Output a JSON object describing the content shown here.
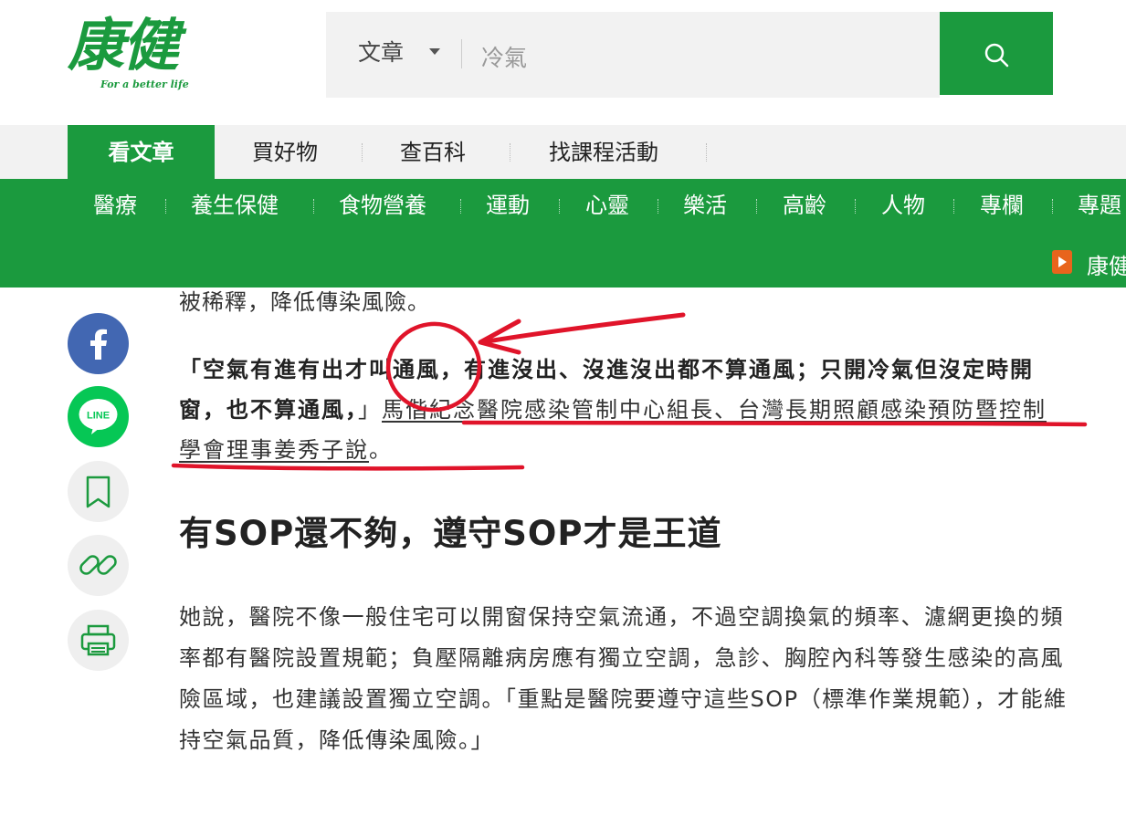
{
  "header": {
    "logo_text": "康健",
    "logo_tagline": "For a better life",
    "search_category": "文章",
    "search_value": "冷氣"
  },
  "main_nav": [
    {
      "label": "看文章",
      "active": true
    },
    {
      "label": "買好物",
      "active": false
    },
    {
      "label": "查百科",
      "active": false
    },
    {
      "label": "找課程活動",
      "active": false
    }
  ],
  "sub_nav": [
    "醫療",
    "養生保健",
    "食物營養",
    "運動",
    "心靈",
    "樂活",
    "高齡",
    "人物",
    "專欄",
    "專題"
  ],
  "sub_nav_extra": "康健",
  "share_icons": [
    "facebook-icon",
    "line-icon",
    "bookmark-icon",
    "link-icon",
    "print-icon"
  ],
  "share_labels": {
    "line": "LINE"
  },
  "article": {
    "p1": "被稀釋，降低傳染風險。",
    "p2_bold": "「空氣有進有出才叫通風，有進沒出、沒進沒出都不算通風；只開冷氣但沒定時開窗，也不算通風，",
    "p2_close": "」",
    "p2_link": "馬偕紀念醫院感染管制中心組長、台灣長期照顧感染預防暨控制學會理事姜秀子說",
    "p2_end": "。",
    "h2": "有SOP還不夠，遵守SOP才是王道",
    "p3": "她說，醫院不像一般住宅可以開窗保持空氣流通，不過空調換氣的頻率、濾網更換的頻率都有醫院設置規範；負壓隔離病房應有獨立空調，急診、胸腔內科等發生感染的高風險區域，也建議設置獨立空調。「重點是醫院要遵守這些SOP（標準作業規範），才能維持空氣品質，降低傳染風險。」"
  },
  "colors": {
    "brand_green": "#1b9a3e",
    "annotation_red": "#e0142a",
    "facebook_blue": "#4267b2",
    "line_green": "#06c755"
  }
}
